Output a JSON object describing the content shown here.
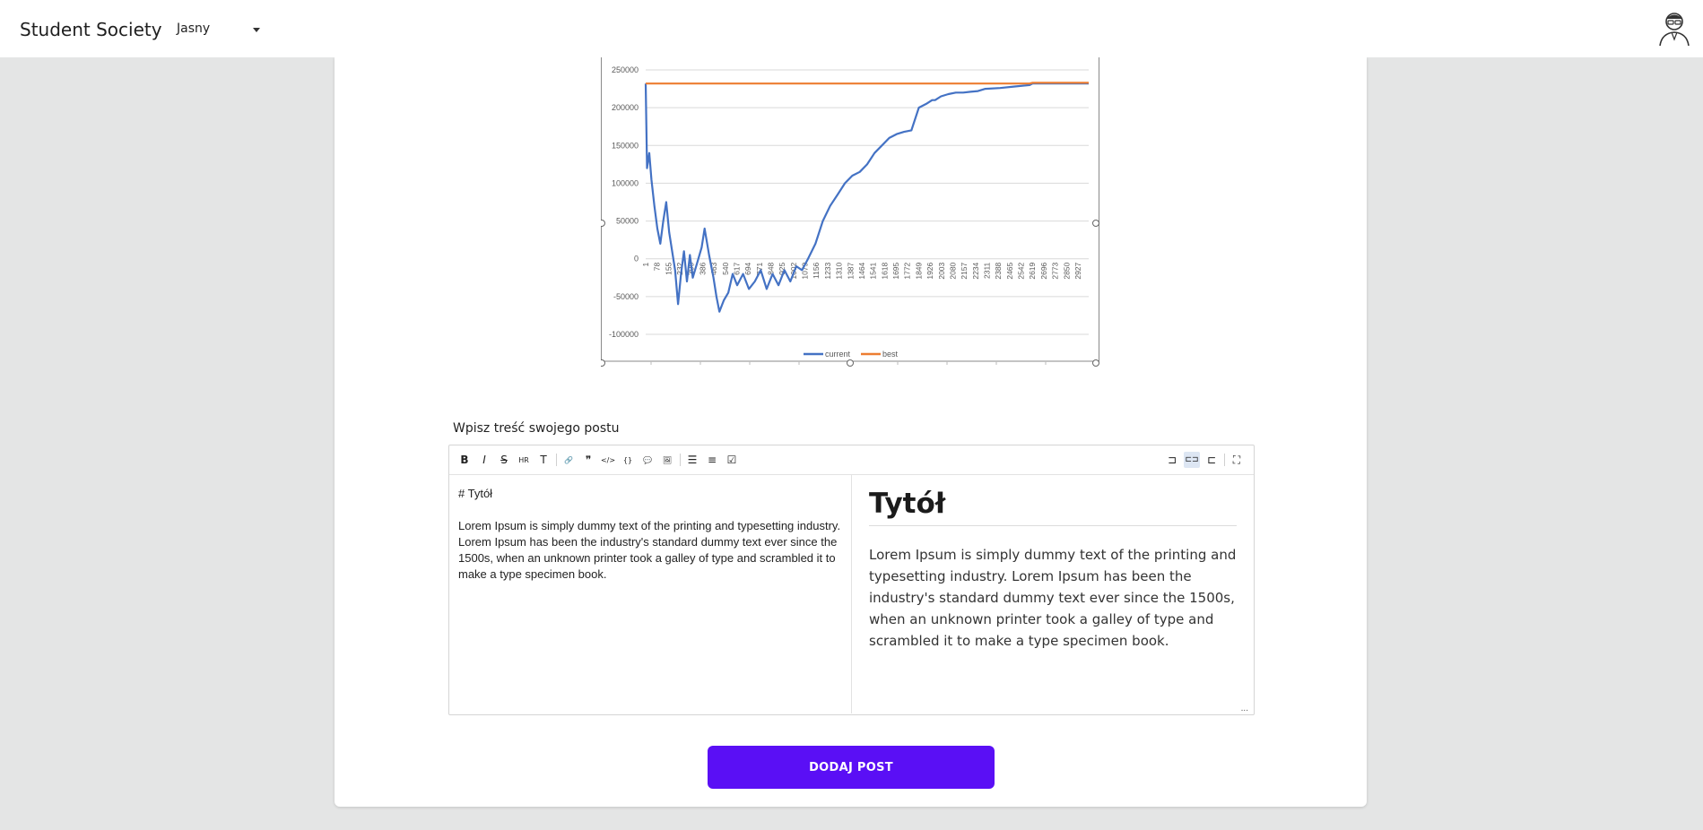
{
  "header": {
    "brand": "Student Society",
    "theme_value": "Jasny",
    "avatar_icon": "avatar-icon"
  },
  "chart_data": {
    "type": "line",
    "ylim": [
      -100000,
      250000
    ],
    "yticks": [
      "250000",
      "200000",
      "150000",
      "100000",
      "50000",
      "0",
      "-50000",
      "-100000"
    ],
    "xticks": [
      "1",
      "78",
      "155",
      "232",
      "309",
      "386",
      "463",
      "540",
      "617",
      "694",
      "771",
      "848",
      "925",
      "1002",
      "1079",
      "1156",
      "1233",
      "1310",
      "1387",
      "1464",
      "1541",
      "1618",
      "1695",
      "1772",
      "1849",
      "1926",
      "2003",
      "2080",
      "2157",
      "2234",
      "2311",
      "2388",
      "2465",
      "2542",
      "2619",
      "2696",
      "2773",
      "2850",
      "2927"
    ],
    "xlim": [
      1,
      3000
    ],
    "series": [
      {
        "name": "current",
        "color": "#4472c4",
        "x": [
          1,
          10,
          25,
          40,
          60,
          80,
          100,
          120,
          140,
          160,
          180,
          200,
          220,
          240,
          260,
          280,
          300,
          320,
          350,
          380,
          400,
          430,
          460,
          480,
          500,
          530,
          560,
          590,
          620,
          660,
          700,
          740,
          780,
          820,
          860,
          900,
          940,
          980,
          1020,
          1060,
          1100,
          1150,
          1200,
          1250,
          1300,
          1350,
          1400,
          1450,
          1500,
          1550,
          1600,
          1650,
          1700,
          1750,
          1800,
          1850,
          1900,
          1940,
          1960,
          2000,
          2050,
          2100,
          2150,
          2200,
          2250,
          2300,
          2400,
          2500,
          2600,
          2620,
          2700,
          3000
        ],
        "values": [
          232000,
          120000,
          140000,
          105000,
          70000,
          40000,
          20000,
          50000,
          75000,
          35000,
          10000,
          -15000,
          -60000,
          -20000,
          10000,
          -30000,
          5000,
          -25000,
          -5000,
          15000,
          40000,
          5000,
          -25000,
          -50000,
          -70000,
          -55000,
          -45000,
          -20000,
          -35000,
          -20000,
          -40000,
          -30000,
          -15000,
          -40000,
          -20000,
          -35000,
          -15000,
          -30000,
          -10000,
          -15000,
          0,
          20000,
          50000,
          70000,
          85000,
          100000,
          110000,
          115000,
          125000,
          140000,
          150000,
          160000,
          165000,
          168000,
          170000,
          200000,
          205000,
          210000,
          210000,
          215000,
          218000,
          220000,
          220000,
          221000,
          222000,
          225000,
          226000,
          228000,
          230000,
          232000,
          232000,
          232000
        ]
      },
      {
        "name": "best",
        "color": "#ed7d31",
        "x": [
          1,
          2600,
          2620,
          3000
        ],
        "values": [
          232000,
          232000,
          233000,
          233000
        ]
      }
    ],
    "legend": "bottom-center",
    "grid": true
  },
  "editor": {
    "prompt_label": "Wpisz treść swojego postu",
    "toolbar_left": [
      {
        "icon": "bold-icon",
        "glyph": "B"
      },
      {
        "icon": "italic-icon",
        "glyph": "I"
      },
      {
        "icon": "strikethrough-icon",
        "glyph": "S"
      },
      {
        "icon": "hr-icon",
        "glyph": "HR"
      },
      {
        "icon": "title-icon",
        "glyph": "T"
      },
      {
        "icon": "link-icon",
        "glyph": "🔗"
      },
      {
        "icon": "quote-icon",
        "glyph": "❞"
      },
      {
        "icon": "code-icon",
        "glyph": "</>"
      },
      {
        "icon": "code-block-icon",
        "glyph": "{}"
      },
      {
        "icon": "comment-icon",
        "glyph": "💬"
      },
      {
        "icon": "image-icon",
        "glyph": "🖼"
      },
      {
        "icon": "unordered-list-icon",
        "glyph": "☰"
      },
      {
        "icon": "ordered-list-icon",
        "glyph": "≡"
      },
      {
        "icon": "checklist-icon",
        "glyph": "☑"
      }
    ],
    "toolbar_right": [
      {
        "icon": "edit-mode-icon",
        "glyph": "⊐"
      },
      {
        "icon": "split-mode-icon",
        "glyph": "⊏⊐",
        "active": true
      },
      {
        "icon": "preview-mode-icon",
        "glyph": "⊏"
      },
      {
        "icon": "fullscreen-icon",
        "glyph": "⛶"
      }
    ],
    "source_heading": "# Tytół",
    "source_body": "Lorem Ipsum is simply dummy text of the printing and typesetting industry. Lorem Ipsum has been the industry's standard dummy text ever since the 1500s, when an unknown printer took a galley of type and scrambled it to make a type specimen book.",
    "preview_heading": "Tytół",
    "preview_body": "Lorem Ipsum is simply dummy text of the printing and typesetting industry. Lorem Ipsum has been the industry's standard dummy text ever since the 1500s, when an unknown printer took a galley of type and scrambled it to make a type specimen book.",
    "resize_glyph": "..."
  },
  "submit_label": "DODAJ POST"
}
